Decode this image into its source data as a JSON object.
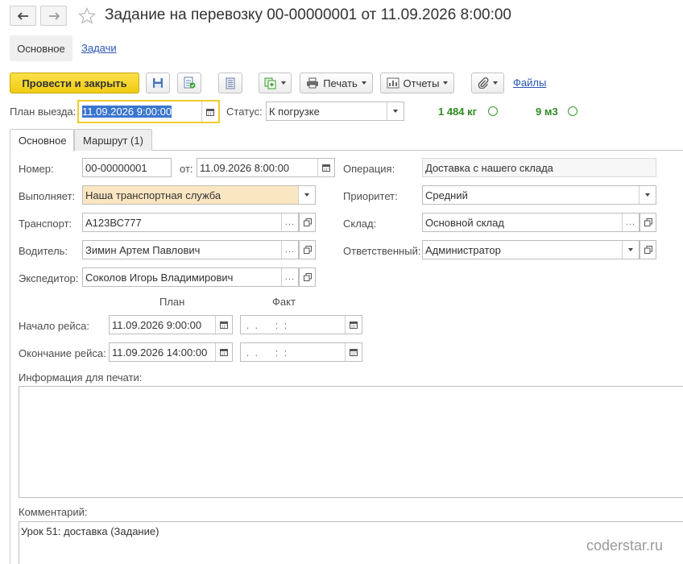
{
  "window": {
    "title": "Задание на перевозку 00-00000001 от 11.09.2026 8:00:00"
  },
  "nav": {
    "main_tab": "Основное",
    "tasks_link": "Задачи"
  },
  "toolbar": {
    "post_close": "Провести и закрыть",
    "print": "Печать",
    "reports": "Отчеты",
    "files": "Файлы"
  },
  "top": {
    "departure_label": "План выезда:",
    "departure_value": "11.09.2026  9:00:00",
    "status_label": "Статус:",
    "status_value": "К погрузке",
    "weight": "1 484 кг",
    "volume": "9 м3"
  },
  "tabs": [
    {
      "label": "Основное"
    },
    {
      "label": "Маршрут (1)"
    }
  ],
  "form": {
    "number_label": "Номер:",
    "number_value": "00-00000001",
    "date_label": "от:",
    "date_value": "11.09.2026  8:00:00",
    "operation_label": "Операция:",
    "operation_value": "Доставка с нашего склада",
    "executor_label": "Выполняет:",
    "executor_value": "Наша транспортная служба",
    "priority_label": "Приоритет:",
    "priority_value": "Средний",
    "transport_label": "Транспорт:",
    "transport_value": "А123ВС777",
    "warehouse_label": "Склад:",
    "warehouse_value": "Основной склад",
    "driver_label": "Водитель:",
    "driver_value": "Зимин Артем Павлович",
    "responsible_label": "Ответственный:",
    "responsible_value": "Администратор",
    "forwarder_label": "Экспедитор:",
    "forwarder_value": "Соколов Игорь Владимирович",
    "plan_header": "План",
    "fact_header": "Факт",
    "trip_start_label": "Начало рейса:",
    "trip_start_plan": "11.09.2026  9:00:00",
    "trip_start_fact": " .  .      :  :",
    "trip_end_label": "Окончание рейса:",
    "trip_end_plan": "11.09.2026 14:00:00",
    "trip_end_fact": " .  .      :  :",
    "print_info_label": "Информация для печати:",
    "print_info_value": "",
    "comment_label": "Комментарий:",
    "comment_value": "Урок 51: доставка (Задание)"
  },
  "watermark": "coderstar.ru",
  "colors": {
    "accent_yellow": "#f5d21c",
    "highlight_field": "#fbe6c2",
    "status_green": "#2e8b22",
    "link_blue": "#2a55b4"
  }
}
